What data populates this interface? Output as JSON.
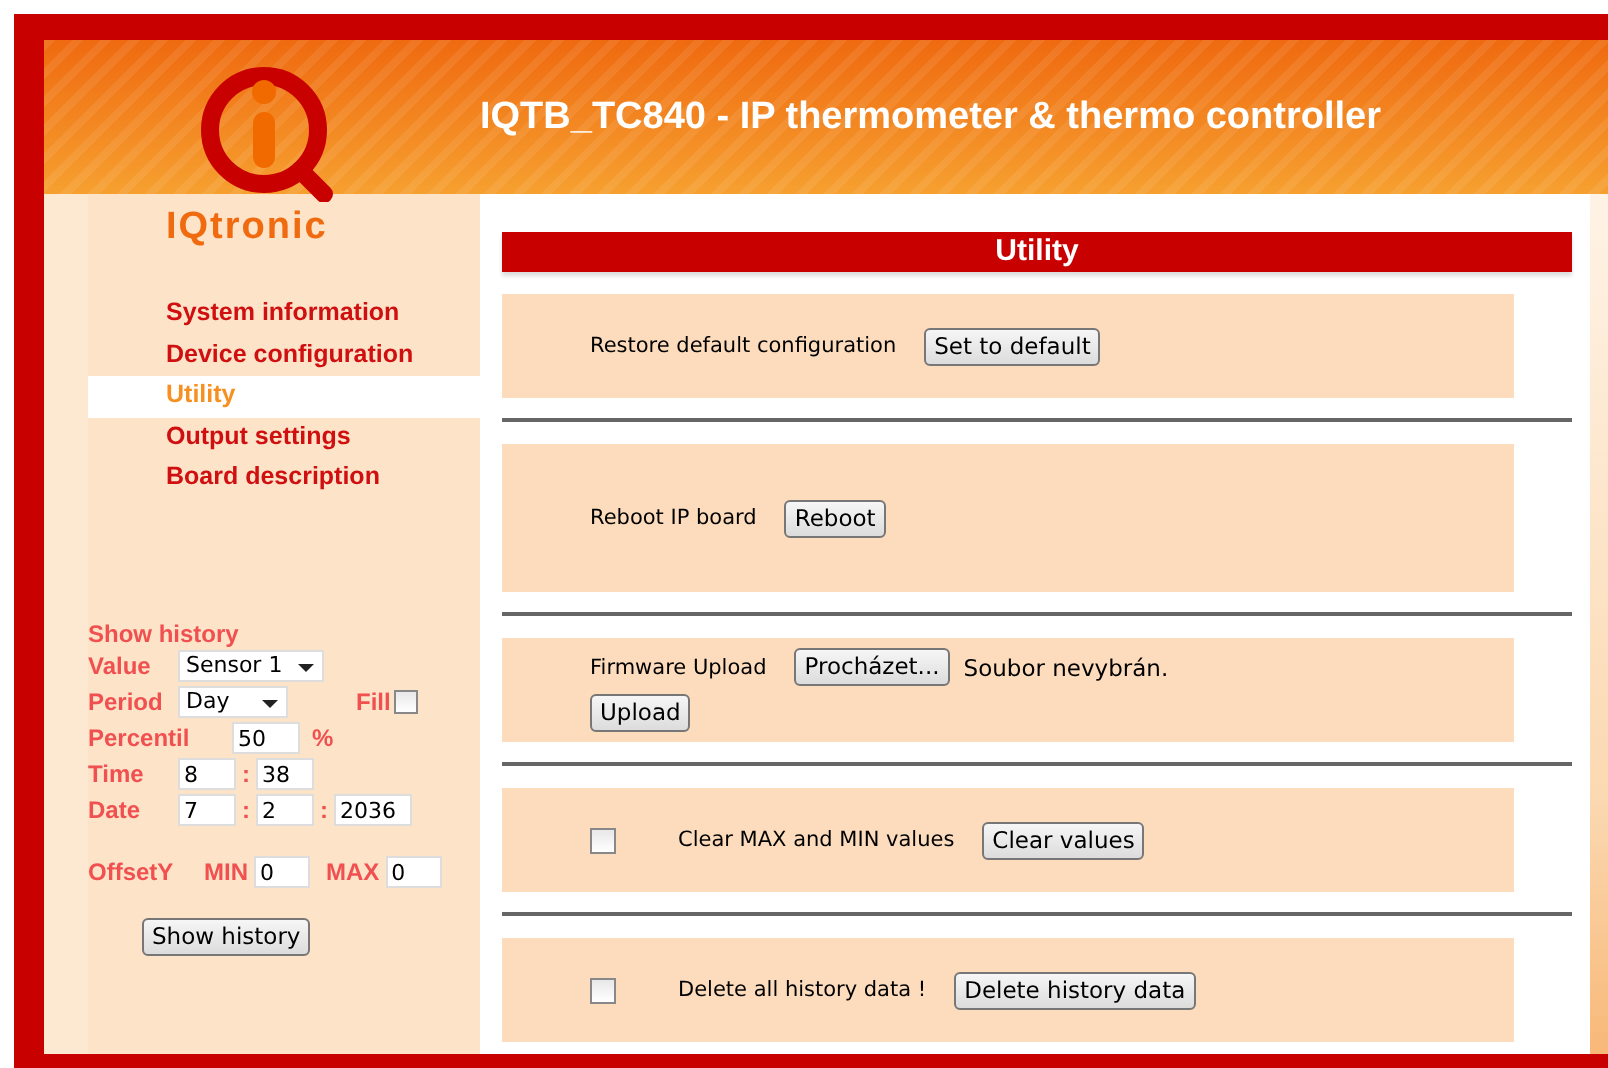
{
  "header": {
    "title": "IQTB_TC840 - IP thermometer & thermo controller",
    "logo_text": "IQtronic"
  },
  "sidebar": {
    "menu": [
      {
        "label": "System information",
        "selected": false
      },
      {
        "label": "Device configuration",
        "selected": false
      },
      {
        "label": "Utility",
        "selected": true
      },
      {
        "label": "Output settings",
        "selected": false
      },
      {
        "label": "Board description",
        "selected": false
      }
    ]
  },
  "history": {
    "title": "Show history",
    "value": {
      "label": "Value",
      "selected": "Sensor 1"
    },
    "period": {
      "label": "Period",
      "selected": "Day"
    },
    "fill": {
      "label": "Fill",
      "checked": false
    },
    "percentil": {
      "label": "Percentil",
      "value": "50",
      "unit": "%"
    },
    "time": {
      "label": "Time",
      "fields": [
        "8",
        "38"
      ],
      "separator": ":"
    },
    "date": {
      "label": "Date",
      "fields": [
        "7",
        "2",
        "2036"
      ],
      "separator": ":"
    },
    "offset": {
      "label": "OffsetY",
      "min_label": "MIN",
      "min": "0",
      "max_label": "MAX",
      "max": "0"
    },
    "button": "Show history"
  },
  "utility": {
    "title": "Utility",
    "sections": [
      {
        "kind": "button",
        "label": "Restore default configuration",
        "button": "Set to default"
      },
      {
        "kind": "button",
        "label": "Reboot IP board",
        "button": "Reboot"
      },
      {
        "kind": "upload",
        "label": "Firmware Upload",
        "browse_button": "Procházet...",
        "file_status": "Soubor nevybrán.",
        "button": "Upload"
      },
      {
        "kind": "checkbox",
        "checked": false,
        "label": "Clear MAX and MIN values",
        "button": "Clear values"
      },
      {
        "kind": "checkbox",
        "checked": false,
        "label": "Delete all history data !",
        "button": "Delete history data"
      }
    ]
  }
}
